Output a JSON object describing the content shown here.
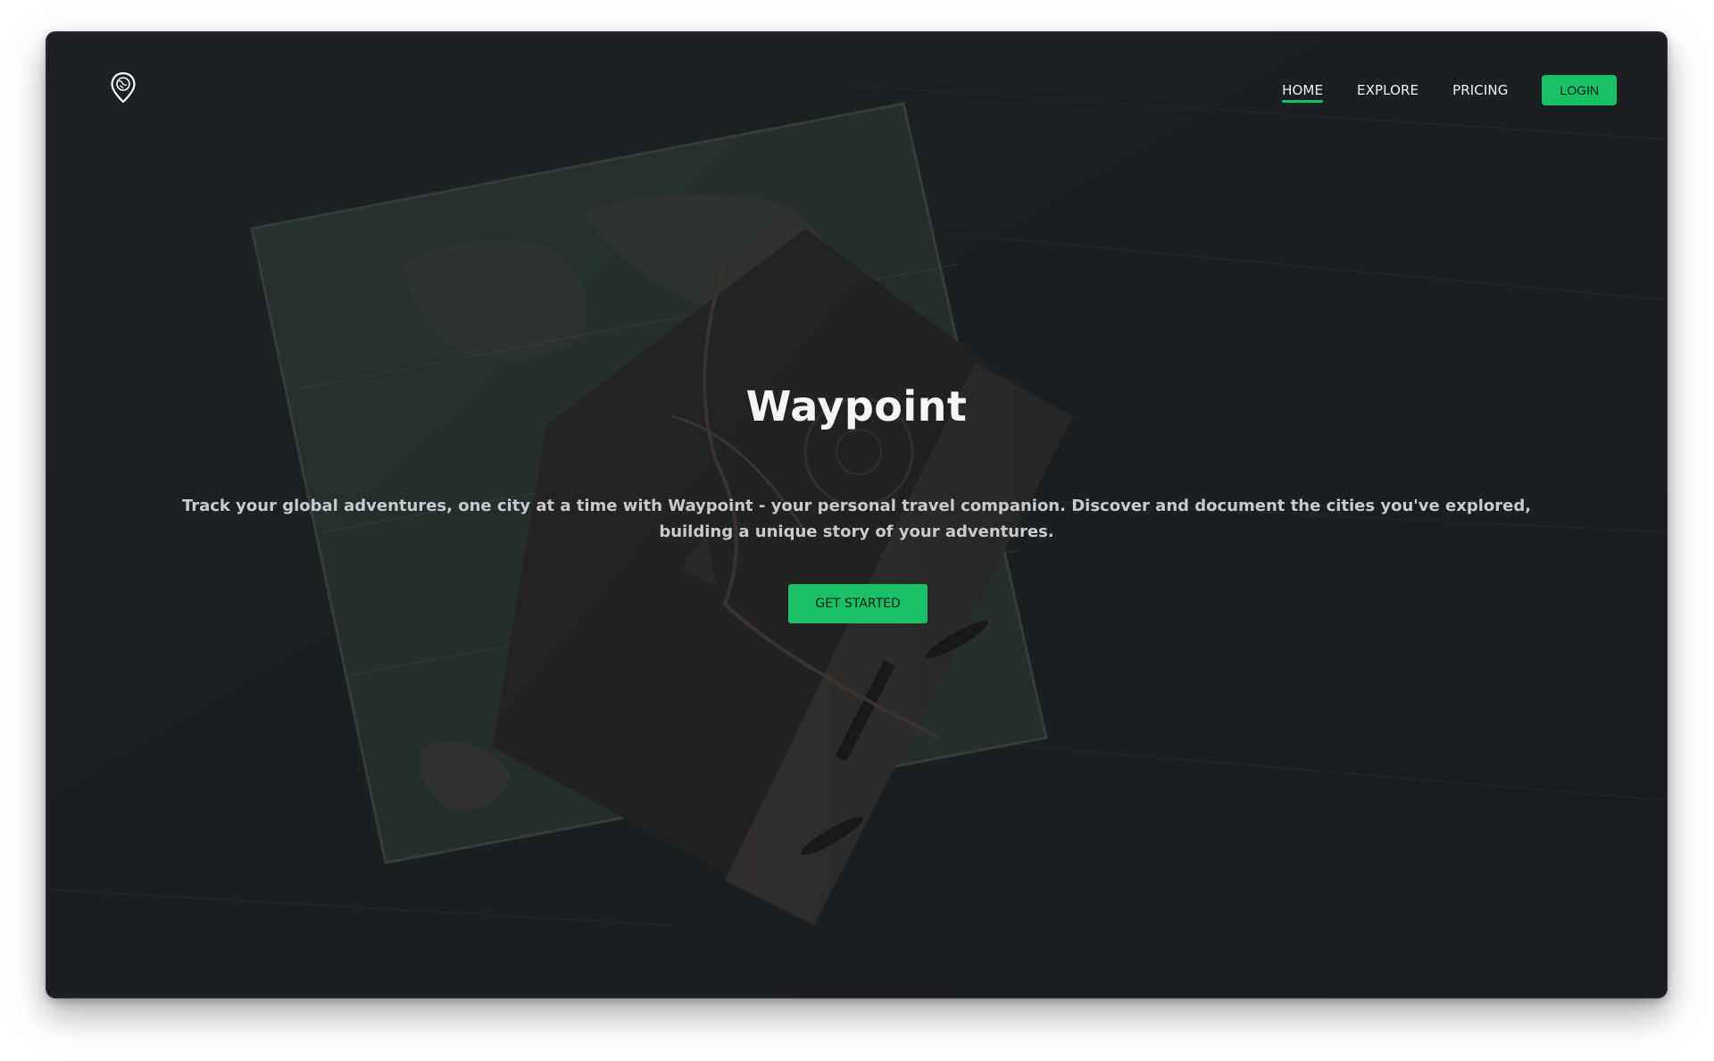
{
  "brand": {
    "logo_icon": "map-pin-globe-icon"
  },
  "nav": {
    "items": [
      {
        "label": "HOME",
        "active": true
      },
      {
        "label": "EXPLORE",
        "active": false
      },
      {
        "label": "PRICING",
        "active": false
      }
    ],
    "login_label": "LOGIN"
  },
  "hero": {
    "title": "Waypoint",
    "description": "Track your global adventures, one city at a time with Waypoint - your personal travel companion. Discover and document the cities you've explored, building a unique story of your adventures.",
    "cta_label": "GET STARTED"
  },
  "colors": {
    "accent": "#19c166",
    "background": "#1e2326",
    "text": "#f4f6f7"
  },
  "background_image": "dark desk with world map book and leather journal"
}
